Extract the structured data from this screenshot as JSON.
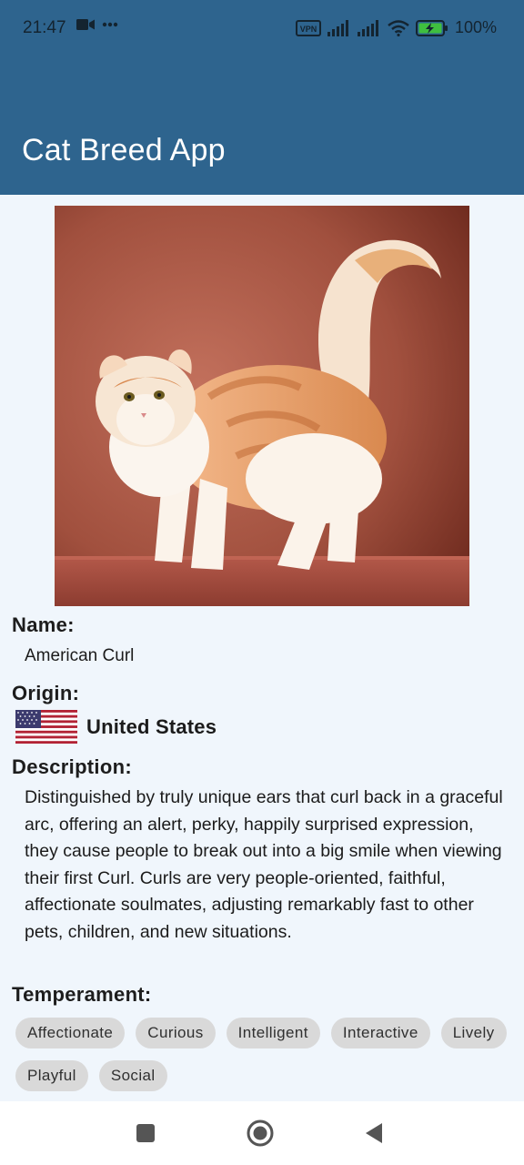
{
  "status_bar": {
    "time": "21:47",
    "battery_percent": "100%",
    "vpn_label": "VPN",
    "icons": [
      "video-camera-icon",
      "more-dots-icon",
      "vpn-icon",
      "signal-icon",
      "signal-icon",
      "wifi-icon",
      "battery-charging-icon"
    ]
  },
  "app_bar": {
    "title": "Cat Breed App"
  },
  "breed": {
    "name_label": "Name:",
    "name": "American Curl",
    "origin_label": "Origin:",
    "origin": "United States",
    "description_label": "Description:",
    "description": "Distinguished by truly unique ears that curl back in a graceful arc, offering an alert, perky, happily surprised expression, they cause people to break out into a big smile when viewing their first Curl. Curls are very people-oriented, faithful, affectionate soulmates, adjusting remarkably fast to other pets, children, and new situations.",
    "temperament_label": "Temperament:",
    "temperament": [
      "Affectionate",
      "Curious",
      "Intelligent",
      "Interactive",
      "Lively",
      "Playful",
      "Social"
    ]
  },
  "nav_bar": {
    "icons": [
      "recents-square-icon",
      "home-circle-icon",
      "back-triangle-icon"
    ]
  },
  "colors": {
    "app_bar": "#2e648e",
    "background": "#f0f6fc",
    "chip": "#d9d9d9"
  }
}
